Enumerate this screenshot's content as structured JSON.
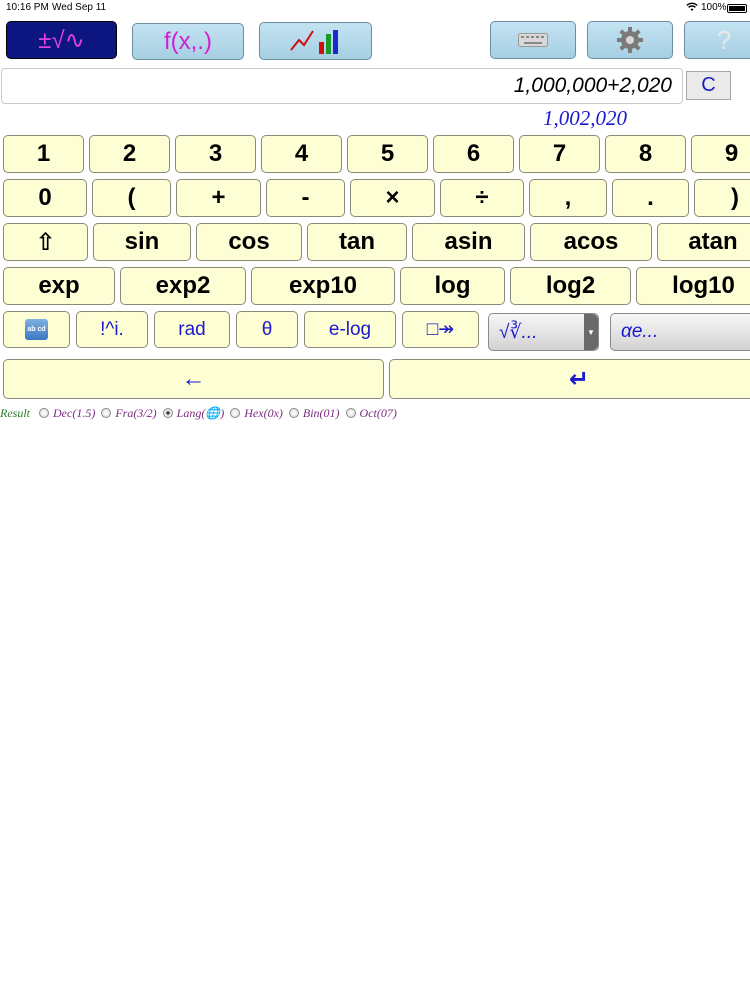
{
  "status_bar": {
    "time": "10:16 PM",
    "date": "Wed Sep 11",
    "battery": "100%"
  },
  "toolbar": {
    "calc_label": "±√∿",
    "func_label": "f(x,.)"
  },
  "expression": {
    "value": "1,000,000+2,020",
    "clear_label": "C"
  },
  "result": {
    "value": "1,002,020"
  },
  "keypad": {
    "row1": [
      "1",
      "2",
      "3",
      "4",
      "5",
      "6",
      "7",
      "8",
      "9"
    ],
    "row2": [
      "0",
      "(",
      "+",
      "-",
      "×",
      "÷",
      ",",
      ".",
      ")"
    ],
    "row3": [
      "⇧",
      "sin",
      "cos",
      "tan",
      "asin",
      "acos",
      "atan"
    ],
    "row4": [
      "exp",
      "exp2",
      "exp10",
      "log",
      "log2",
      "log10"
    ],
    "row5": {
      "keyboard_icon_label": "ab cd",
      "fact_label": "!^i.",
      "rad_label": "rad",
      "theta_label": "θ",
      "elog_label": "e-log",
      "box_label": "□↠",
      "roots_dropdown": "√∛...",
      "greek_dropdown": "αe..."
    },
    "row6": {
      "backspace_label": "←",
      "enter_label": "↵"
    }
  },
  "result_format": {
    "label": "Result",
    "options": [
      {
        "label": "Dec(1.5)",
        "selected": false
      },
      {
        "label": "Fra(3/2)",
        "selected": false
      },
      {
        "label": "Lang(🌐)",
        "selected": true
      },
      {
        "label": "Hex(0x)",
        "selected": false
      },
      {
        "label": "Bin(01)",
        "selected": false
      },
      {
        "label": "Oct(07)",
        "selected": false
      }
    ]
  },
  "colors": {
    "key_bg": "#fefed4",
    "toolbar_bg": "#b4d9ea",
    "active_tab": "#0d1580",
    "accent_text": "#1a1acc"
  }
}
